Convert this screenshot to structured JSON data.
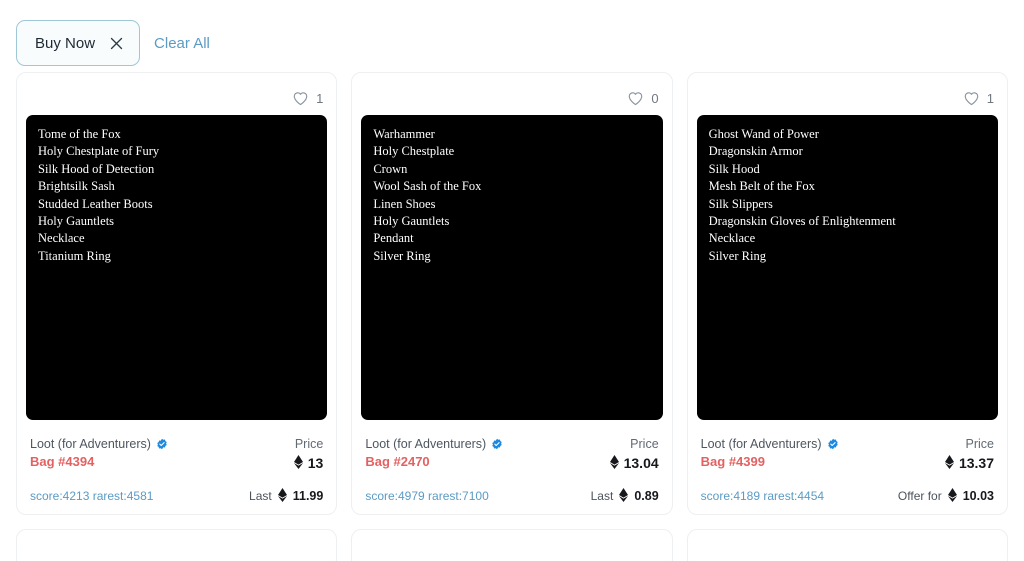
{
  "filter_bar": {
    "chips": [
      {
        "label": "Buy Now",
        "close_icon": "close-icon"
      }
    ],
    "clear_all_label": "Clear All"
  },
  "icons": {
    "heart": "heart-outline-icon",
    "verified": "verified-badge-icon",
    "eth": "ethereum-icon",
    "close": "close-icon"
  },
  "colors": {
    "chip_border": "#9fc7d6",
    "chip_bg": "#f8fcfd",
    "link_blue": "#5b9bc4",
    "bag_red": "#e36161",
    "art_bg": "#000000",
    "card_border": "#edeff1",
    "verified_blue": "#1d8ae0"
  },
  "cards": [
    {
      "like_count": "1",
      "items": [
        "Tome of the Fox",
        "Holy Chestplate of Fury",
        "Silk Hood of Detection",
        "Brightsilk Sash",
        "Studded Leather Boots",
        "Holy Gauntlets",
        "Necklace",
        "Titanium Ring"
      ],
      "collection": "Loot (for Adventurers)",
      "bag_name": "Bag #4394",
      "price_label": "Price",
      "price_value": "13",
      "eth_symbol": "♦",
      "secondary_label": "Last",
      "secondary_value": "11.99",
      "score": "score:4213 rarest:4581"
    },
    {
      "like_count": "0",
      "items": [
        "Warhammer",
        "Holy Chestplate",
        "Crown",
        "Wool Sash of the Fox",
        "Linen Shoes",
        "Holy Gauntlets",
        "Pendant",
        "Silver Ring"
      ],
      "collection": "Loot (for Adventurers)",
      "bag_name": "Bag #2470",
      "price_label": "Price",
      "price_value": "13.04",
      "eth_symbol": "♦",
      "secondary_label": "Last",
      "secondary_value": "0.89",
      "score": "score:4979 rarest:7100"
    },
    {
      "like_count": "1",
      "items": [
        "Ghost Wand of Power",
        "Dragonskin Armor",
        "Silk Hood",
        "Mesh Belt of the Fox",
        "Silk Slippers",
        "Dragonskin Gloves of Enlightenment",
        "Necklace",
        "Silver Ring"
      ],
      "collection": "Loot (for Adventurers)",
      "bag_name": "Bag #4399",
      "price_label": "Price",
      "price_value": "13.37",
      "eth_symbol": "♦",
      "secondary_label": "Offer for",
      "secondary_value": "10.03",
      "score": "score:4189 rarest:4454"
    }
  ]
}
